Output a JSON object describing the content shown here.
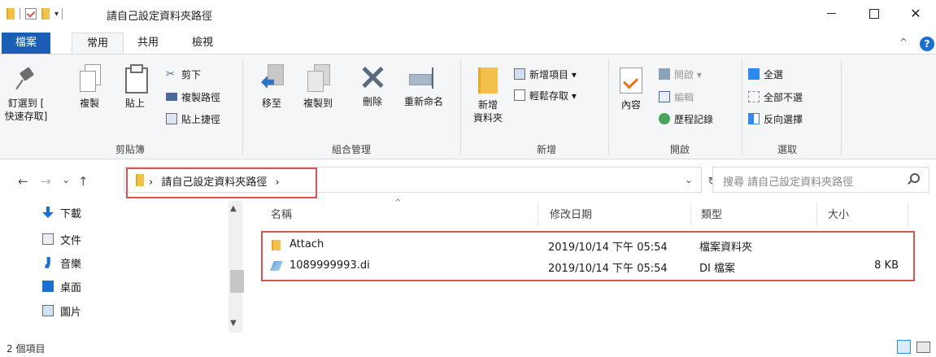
{
  "titlebar": {
    "title": "請自己設定資料夾路徑",
    "qat_dropdown": "▾"
  },
  "tabs": {
    "file": "檔案",
    "home": "常用",
    "share": "共用",
    "view": "檢視",
    "collapse": "^",
    "help": "?"
  },
  "ribbon": {
    "clipboard": {
      "pin_label": "釘選到 [\n快速存取]",
      "copy_label": "複製",
      "paste_label": "貼上",
      "cut_label": "剪下",
      "copy_path_label": "複製路徑",
      "paste_shortcut_label": "貼上捷徑",
      "group_label": "剪貼簿"
    },
    "organize": {
      "move_label": "移至",
      "copy_to_label": "複製到",
      "delete_label": "刪除",
      "rename_label": "重新命名",
      "group_label": "組合管理"
    },
    "new": {
      "new_folder_label": "新增\n資料夾",
      "new_item_label": "新增項目 ▾",
      "easy_access_label": "輕鬆存取 ▾",
      "group_label": "新增"
    },
    "open": {
      "properties_label": "內容",
      "open_label": "開啟 ▾",
      "edit_label": "編輯",
      "history_label": "歷程記錄",
      "group_label": "開啟"
    },
    "select": {
      "select_all_label": "全選",
      "select_none_label": "全部不選",
      "invert_label": "反向選擇",
      "group_label": "選取"
    }
  },
  "address": {
    "path_segment": "請自己設定資料夾路徑",
    "search_placeholder": "搜尋 請自己設定資料夾路徑",
    "back": "←",
    "forward": "→",
    "recent": "⌄",
    "up": "↑",
    "dropdown": "⌄",
    "refresh": "↻"
  },
  "nav_pane": {
    "items": [
      {
        "label": "下載"
      },
      {
        "label": "文件"
      },
      {
        "label": "音樂"
      },
      {
        "label": "桌面"
      },
      {
        "label": "圖片"
      }
    ]
  },
  "file_list": {
    "columns": {
      "name": "名稱",
      "modified": "修改日期",
      "type": "類型",
      "size": "大小"
    },
    "sort_indicator": "^",
    "rows": [
      {
        "name": "Attach",
        "modified": "2019/10/14 下午 05:54",
        "type": "檔案資料夾",
        "size": ""
      },
      {
        "name": "1089999993.di",
        "modified": "2019/10/14 下午 05:54",
        "type": "DI 檔案",
        "size": "8 KB"
      }
    ]
  },
  "status_bar": {
    "item_count": "2 個項目"
  }
}
